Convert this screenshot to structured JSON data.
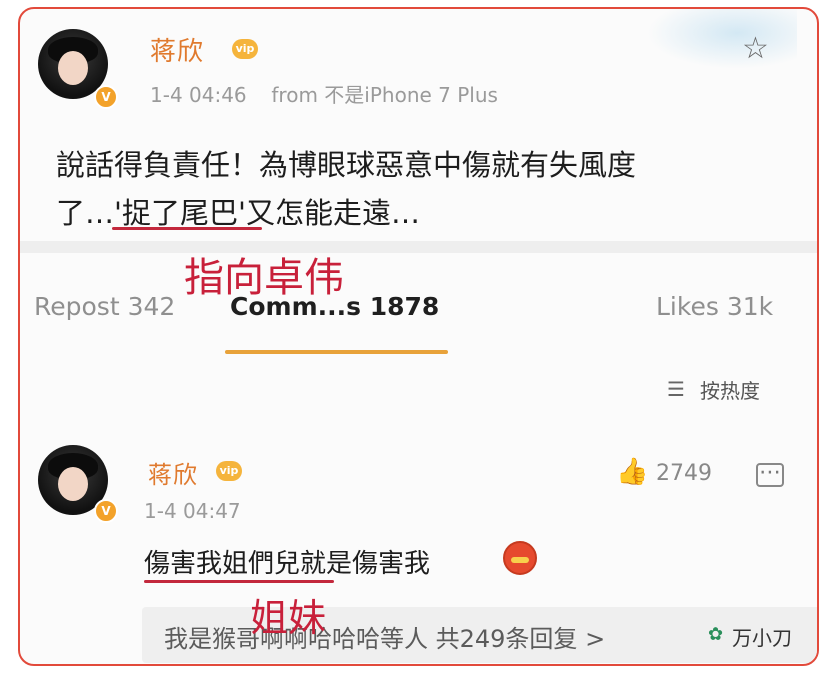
{
  "post": {
    "author": "蒋欣",
    "timestamp": "1-4 04:46",
    "source": "from 不是iPhone 7 Plus",
    "text_line1": "說話得負責任！為博眼球惡意中傷就有失風度",
    "text_line2_part1": "了…'",
    "text_line2_highlight": "捉了尾巴",
    "text_line2_part2": "'又怎能走遠…"
  },
  "annotations": {
    "note1": "指向卓伟",
    "note2": "姐妹"
  },
  "stats": {
    "repost": "Repost 342",
    "comments": "Comm...s 1878",
    "likes": "Likes 31k"
  },
  "sort": {
    "label": "按热度"
  },
  "comment": {
    "author": "蒋欣",
    "timestamp": "1-4 04:47",
    "text": "傷害我姐們兒就是傷害我",
    "likes": "2749",
    "replies_text": "我是猴哥啊啊哈哈哈等人  共249条回复 >"
  },
  "watermark": {
    "text": "万小刀"
  },
  "icons": {
    "star": "star-icon",
    "like": "thumbs-up-icon",
    "comment": "comment-icon",
    "sort": "sort-icon",
    "verified": "verified-badge-icon",
    "vip": "vip-badge-icon",
    "wechat": "wechat-icon"
  },
  "colors": {
    "accent": "#e8a23a",
    "name": "#e07a2e",
    "annotation": "#c8203a",
    "frame": "#e24a3b"
  }
}
